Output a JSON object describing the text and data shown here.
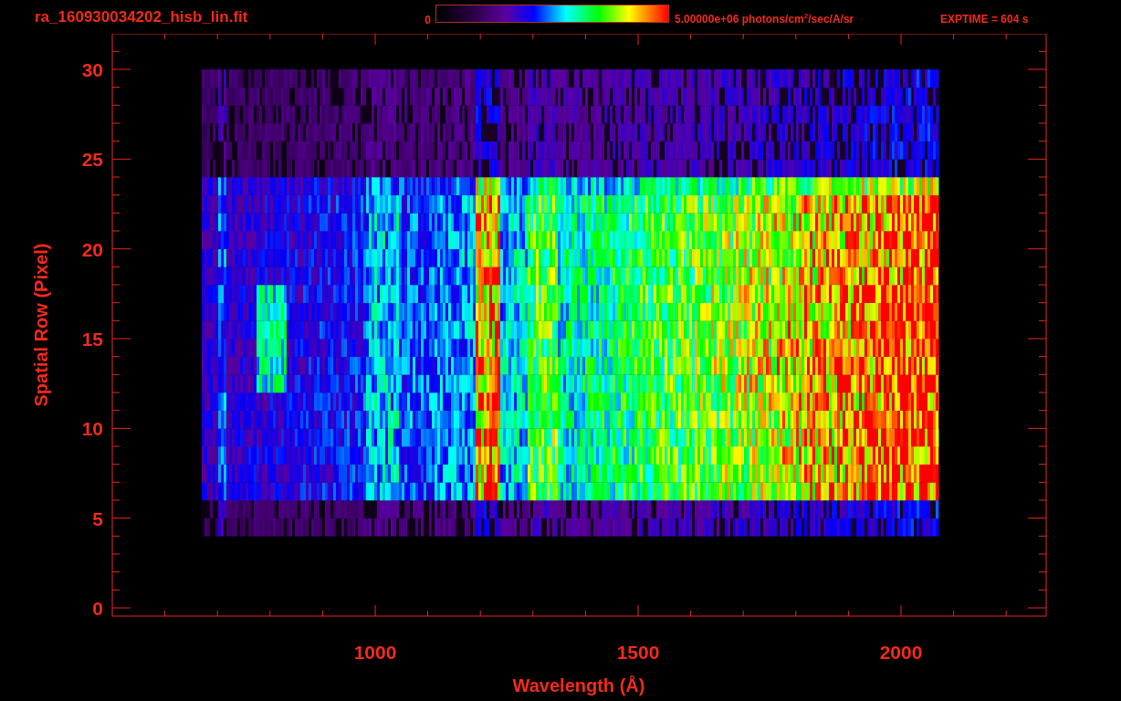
{
  "title": "ra_160930034202_hisb_lin.fit",
  "colorbar": {
    "min_label": "0",
    "max_label": "5.00000e+06 photons/cm$^{2}$/sec/A/sr"
  },
  "exptime": "EXPTIME = 604 s",
  "x_axis": {
    "label": "Wavelength (Å)",
    "ticks": [
      "1000",
      "1500",
      "2000"
    ]
  },
  "y_axis": {
    "label": "Spatial Row (Pixel)",
    "ticks": [
      "30",
      "25",
      "20",
      "15",
      "10",
      "5",
      "0"
    ]
  }
}
